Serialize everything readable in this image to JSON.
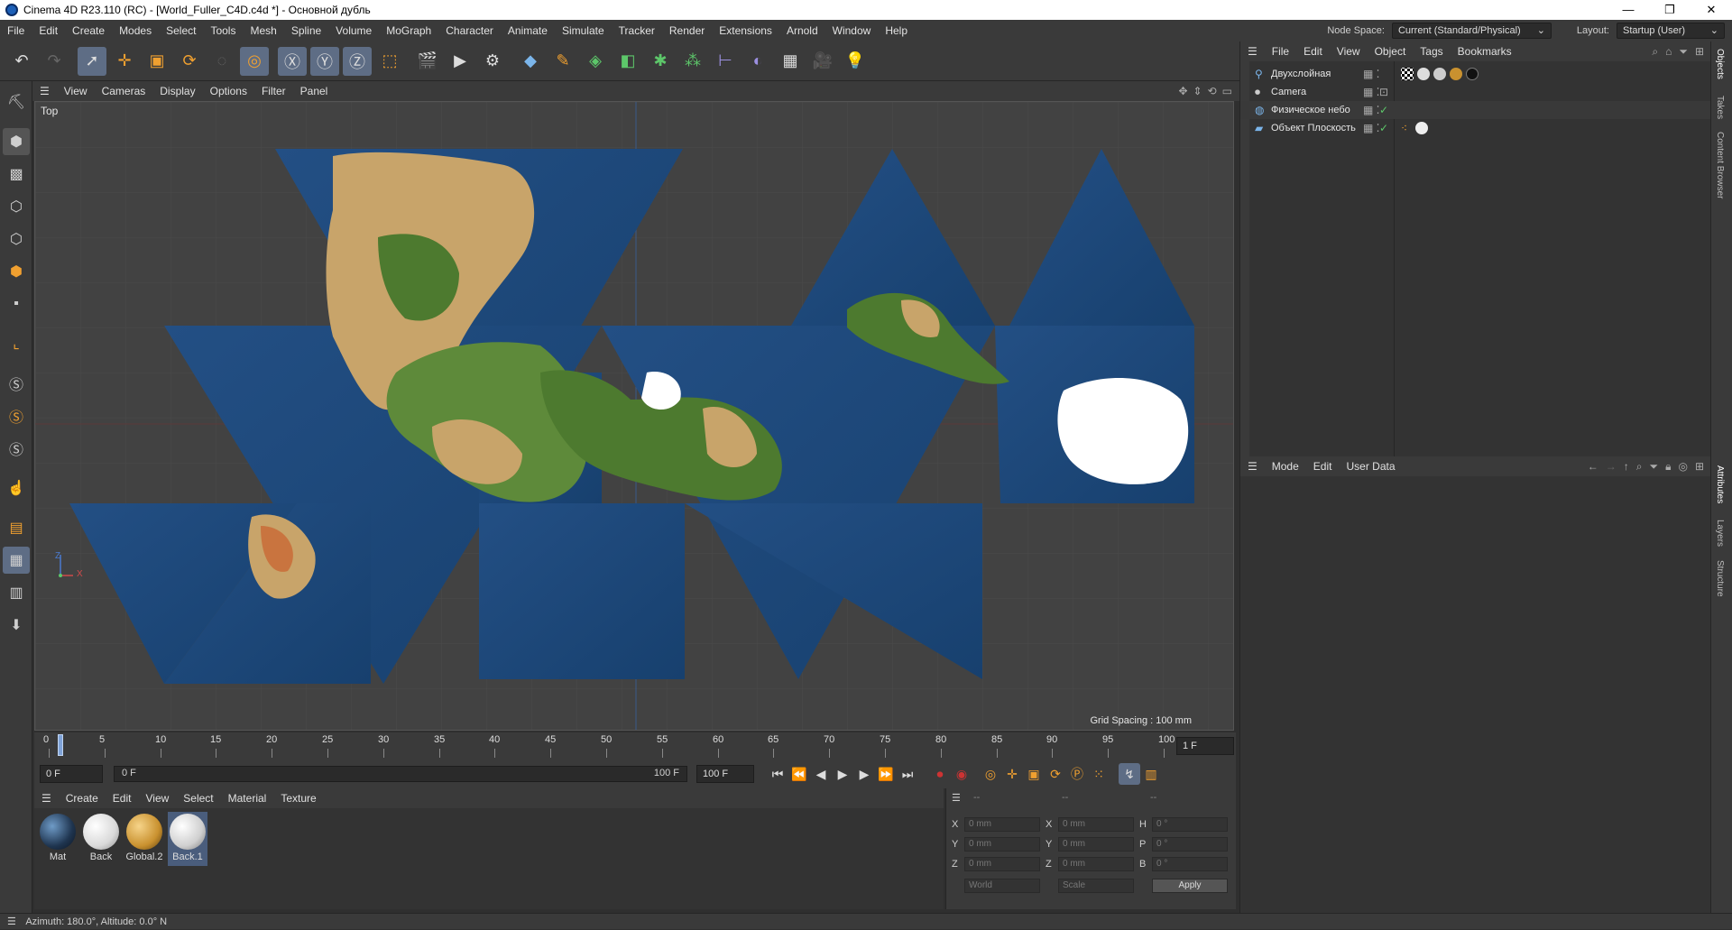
{
  "window": {
    "title": "Cinema 4D R23.110 (RC) - [World_Fuller_C4D.c4d *] - Основной дубль",
    "controls": [
      "—",
      "❐",
      "✕"
    ]
  },
  "menubar": {
    "items": [
      "File",
      "Edit",
      "Create",
      "Modes",
      "Select",
      "Tools",
      "Mesh",
      "Spline",
      "Volume",
      "MoGraph",
      "Character",
      "Animate",
      "Simulate",
      "Tracker",
      "Render",
      "Extensions",
      "Arnold",
      "Window",
      "Help"
    ],
    "node_space_label": "Node Space:",
    "node_space_value": "Current (Standard/Physical)",
    "layout_label": "Layout:",
    "layout_value": "Startup (User)"
  },
  "viewport": {
    "menu": [
      "View",
      "Cameras",
      "Display",
      "Options",
      "Filter",
      "Panel"
    ],
    "label": "Top",
    "grid_spacing": "Grid Spacing : 100 mm",
    "axis_z": "Z",
    "axis_x": "X"
  },
  "timeline": {
    "ticks": [
      "0",
      "5",
      "10",
      "15",
      "20",
      "25",
      "30",
      "35",
      "40",
      "45",
      "50",
      "55",
      "60",
      "65",
      "70",
      "75",
      "80",
      "85",
      "90",
      "95",
      "100"
    ],
    "current_frame_field": "1 F",
    "start_field": "0 F",
    "range_start": "0 F",
    "range_end": "100 F",
    "end_field": "100 F"
  },
  "materials": {
    "menu": [
      "Create",
      "Edit",
      "View",
      "Select",
      "Material",
      "Texture"
    ],
    "items": [
      {
        "name": "Mat",
        "color": "#1f3550"
      },
      {
        "name": "Back",
        "color": "#f2f2f2"
      },
      {
        "name": "Global.2",
        "color": "#c9912f"
      },
      {
        "name": "Back.1",
        "color": "#e6e6e6"
      }
    ]
  },
  "coordinates": {
    "headers": [
      "--",
      "--",
      "--"
    ],
    "rows": [
      {
        "l1": "X",
        "v1": "0 mm",
        "l2": "X",
        "v2": "0 mm",
        "l3": "H",
        "v3": "0 °"
      },
      {
        "l1": "Y",
        "v1": "0 mm",
        "l2": "Y",
        "v2": "0 mm",
        "l3": "P",
        "v3": "0 °"
      },
      {
        "l1": "Z",
        "v1": "0 mm",
        "l2": "Z",
        "v2": "0 mm",
        "l3": "B",
        "v3": "0 °"
      }
    ],
    "mode_select": "World",
    "scale_select": "Scale",
    "apply_label": "Apply"
  },
  "objects_panel": {
    "menu": [
      "File",
      "Edit",
      "View",
      "Object",
      "Tags",
      "Bookmarks"
    ],
    "objects": [
      {
        "name": "Двухслойная"
      },
      {
        "name": "Camera"
      },
      {
        "name": "Физическое небо"
      },
      {
        "name": "Объект Плоскость"
      }
    ]
  },
  "attributes_panel": {
    "menu": [
      "Mode",
      "Edit",
      "User Data"
    ]
  },
  "side_tabs": [
    "Objects",
    "Takes",
    "Content Browser",
    "Attributes",
    "Layers",
    "Structure"
  ],
  "status": {
    "text": "Azimuth: 180.0°, Altitude: 0.0°  N"
  },
  "colors": {
    "accent_active": "#5e6d85",
    "ocean": "#1d4f8a",
    "land_green": "#4d7a2f",
    "land_tan": "#c8a46a",
    "ice": "#ffffff"
  }
}
